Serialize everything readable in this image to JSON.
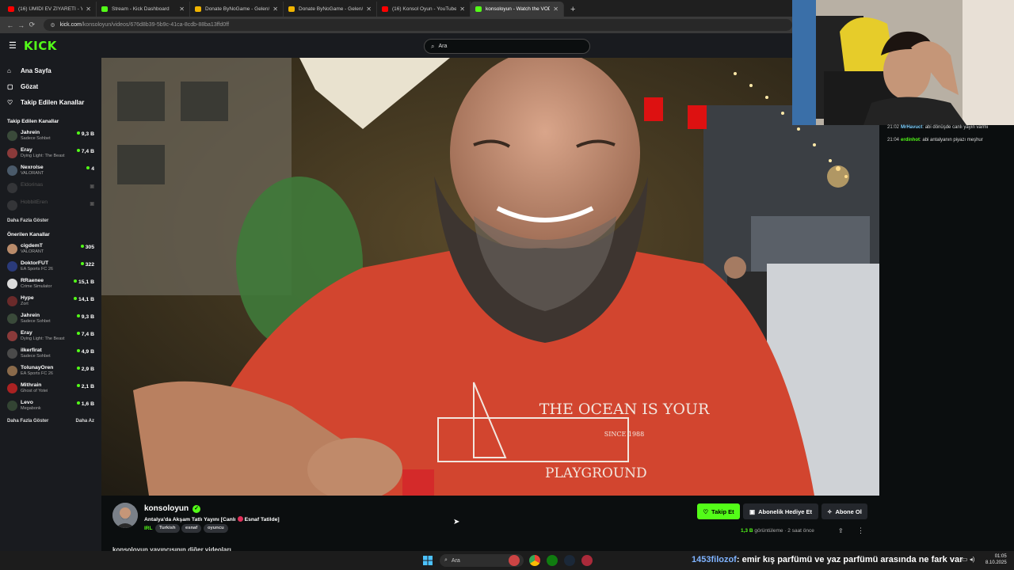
{
  "browser": {
    "tabs": [
      {
        "title": "(16) ÜMİDİ EV ZİYARETİ - YouTube",
        "color": "#ff0000"
      },
      {
        "title": "Stream - Kick Dashboard",
        "color": "#53fc18"
      },
      {
        "title": "Donate ByNoGame - Gelen/Giden",
        "color": "#f0b400"
      },
      {
        "title": "Donate ByNoGame - Gelen/Giden",
        "color": "#f0b400"
      },
      {
        "title": "(16) Konsol Oyun - YouTube",
        "color": "#ff0000"
      },
      {
        "title": "konsoloyun - Watch the VOD",
        "color": "#53fc18"
      }
    ],
    "url_host": "kick.com",
    "url_path": "/konsoloyun/videos/676d8b39-5b9c-41ca-8cdb-88ba13ffd0ff"
  },
  "header": {
    "logo": "KICK",
    "search_placeholder": "Ara"
  },
  "sidebar": {
    "nav": [
      {
        "label": "Ana Sayfa",
        "icon": "home-icon"
      },
      {
        "label": "Gözat",
        "icon": "browse-icon"
      },
      {
        "label": "Takip Edilen Kanallar",
        "icon": "heart-icon"
      }
    ],
    "followed_title": "Takip Edilen Kanallar",
    "followed": [
      {
        "name": "Jahrein",
        "category": "Sadece Sohbet",
        "viewers": "9,3 B",
        "color": "#3a4a3a"
      },
      {
        "name": "Eray",
        "category": "Dying Light: The Beast",
        "viewers": "7,4 B",
        "color": "#8a3a3a"
      },
      {
        "name": "Nexrolse",
        "category": "VALORANT",
        "viewers": "4",
        "color": "#4a5a6a"
      },
      {
        "name": "Eldorinas",
        "category": "",
        "viewers": "",
        "color": "#666"
      },
      {
        "name": "HobbitEren",
        "category": "",
        "viewers": "",
        "color": "#666"
      }
    ],
    "followed_more": "Daha Fazla Göster",
    "recommended_title": "Önerilen Kanallar",
    "recommended": [
      {
        "name": "cigdemT",
        "category": "VALORANT",
        "viewers": "305",
        "color": "#b98b6a"
      },
      {
        "name": "DoktorFUT",
        "category": "EA Sports FC 26",
        "viewers": "322",
        "color": "#2a3a7a"
      },
      {
        "name": "RRaenee",
        "category": "Crime Simulator",
        "viewers": "15,1 B",
        "color": "#dcdcdc"
      },
      {
        "name": "Hype",
        "category": "Zort",
        "viewers": "14,1 B",
        "color": "#6a2a2a"
      },
      {
        "name": "Jahrein",
        "category": "Sadece Sohbet",
        "viewers": "9,3 B",
        "color": "#3a4a3a"
      },
      {
        "name": "Eray",
        "category": "Dying Light: The Beast",
        "viewers": "7,4 B",
        "color": "#8a3a3a"
      },
      {
        "name": "ilkerfirat",
        "category": "Sadece Sohbet",
        "viewers": "4,9 B",
        "color": "#4a4a4a"
      },
      {
        "name": "TolunayOren",
        "category": "EA Sports FC 26",
        "viewers": "2,9 B",
        "color": "#8a6a4a"
      },
      {
        "name": "Mithrain",
        "category": "Ghost of Yotei",
        "viewers": "2,1 B",
        "color": "#aa2222"
      },
      {
        "name": "Levo",
        "category": "Megabonk",
        "viewers": "1,6 B",
        "color": "#334433"
      }
    ],
    "recommended_more": "Daha Fazla Göster",
    "recommended_less": "Daha Az"
  },
  "chat": [
    {
      "time": "21:02",
      "user": "MrHavuct",
      "user_color": "#7fd0ff",
      "message": "abi dönüşde canlı yayın varmı"
    },
    {
      "time": "21:04",
      "user": "erdinhot",
      "user_color": "#53fc18",
      "message": "abi antalyanın piyazı meşhur"
    }
  ],
  "channel": {
    "name": "konsoloyun",
    "title_pre": "Antalya'da Akşam Tatlı Yayını [Canlı",
    "title_post": "Esnaf Tatilde]",
    "category": "IRL",
    "tags": [
      "Turkish",
      "esnaf",
      "oyuncu"
    ],
    "follow_label": "Takip Et",
    "gift_label": "Abonelik Hediye Et",
    "subscribe_label": "Abone Ol",
    "views_count": "1,3 B",
    "views_label": "görüntüleme",
    "age": "2 saat önce",
    "videos_heading": "konsoloyun yayıncısının diğer videoları"
  },
  "video": {
    "shirt_line1": "THE OCEAN IS YOUR",
    "shirt_line2": "SINCE 1988",
    "shirt_line3": "PLAYGROUND"
  },
  "taskbar": {
    "search": "Ara",
    "ticker_user": "1453filozof",
    "ticker_message": ": emir kış parfümü ve yaz parfümü arasında ne fark var",
    "time": "01:05",
    "date": "8.10.2025"
  }
}
